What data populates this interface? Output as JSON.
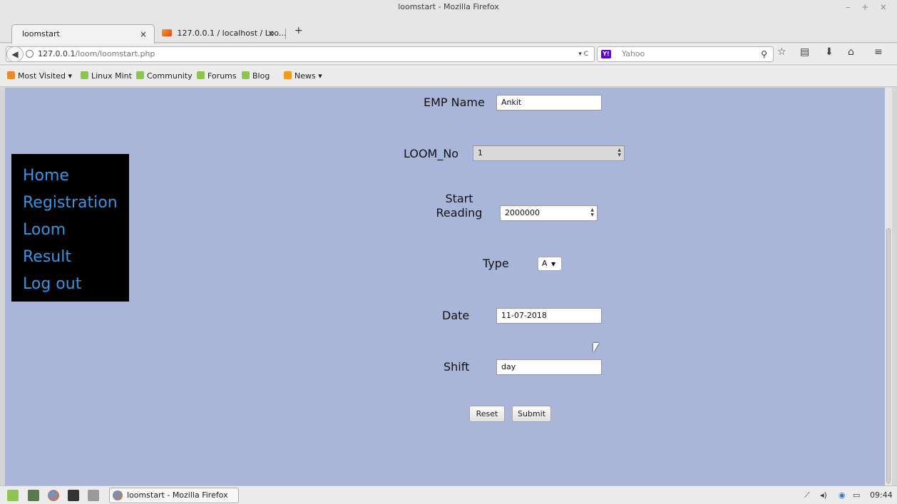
{
  "window": {
    "title": "loomstart - Mozilla Firefox",
    "controls": "– + ×"
  },
  "tabs": [
    {
      "label": "loomstart",
      "close": "×"
    },
    {
      "label": "127.0.0.1 / localhost / Loo...",
      "close": "×"
    }
  ],
  "newtab": "+",
  "nav": {
    "back": "◀",
    "url_host": "127.0.0.1",
    "url_path": "/loom/loomstart.php",
    "url_controls": "▾ C",
    "search_engine": "Y!",
    "search_placeholder": "Yahoo",
    "search_icon": "⚲",
    "toolbar_icons": [
      "☆",
      "▤",
      "⬇",
      "⌂",
      "≡"
    ]
  },
  "bookmarks": [
    {
      "label": "Most Visited ▾",
      "icon": "folder"
    },
    {
      "label": "Linux Mint",
      "icon": "mint"
    },
    {
      "label": "Community",
      "icon": "mint"
    },
    {
      "label": "Forums",
      "icon": "mint"
    },
    {
      "label": "Blog",
      "icon": "mint"
    },
    {
      "label": "News ▾",
      "icon": "rss"
    }
  ],
  "menu": {
    "items": [
      "Home",
      "Registration",
      "Loom",
      "Result",
      "Log out"
    ],
    "link_color": "#3a94e0"
  },
  "form": {
    "emp_name_label": "EMP Name",
    "emp_name_value": "Ankit",
    "loom_no_label": "LOOM_No",
    "loom_no_value": "1",
    "start_reading_label_1": "Start",
    "start_reading_label_2": "Reading",
    "start_reading_value": "2000000",
    "type_label": "Type",
    "type_value": "A",
    "date_label": "Date",
    "date_value": "11-07-2018",
    "shift_label": "Shift",
    "shift_value": "day",
    "reset_label": "Reset",
    "submit_label": "Submit"
  },
  "taskbar": {
    "app_label": "loomstart - Mozilla Firefox",
    "clock": "09:44",
    "tray_icons": [
      "network-icon",
      "volume-icon",
      "update-icon",
      "battery-icon"
    ]
  },
  "colors": {
    "page_bg": "#a9b6da",
    "menu_bg": "#000000"
  }
}
